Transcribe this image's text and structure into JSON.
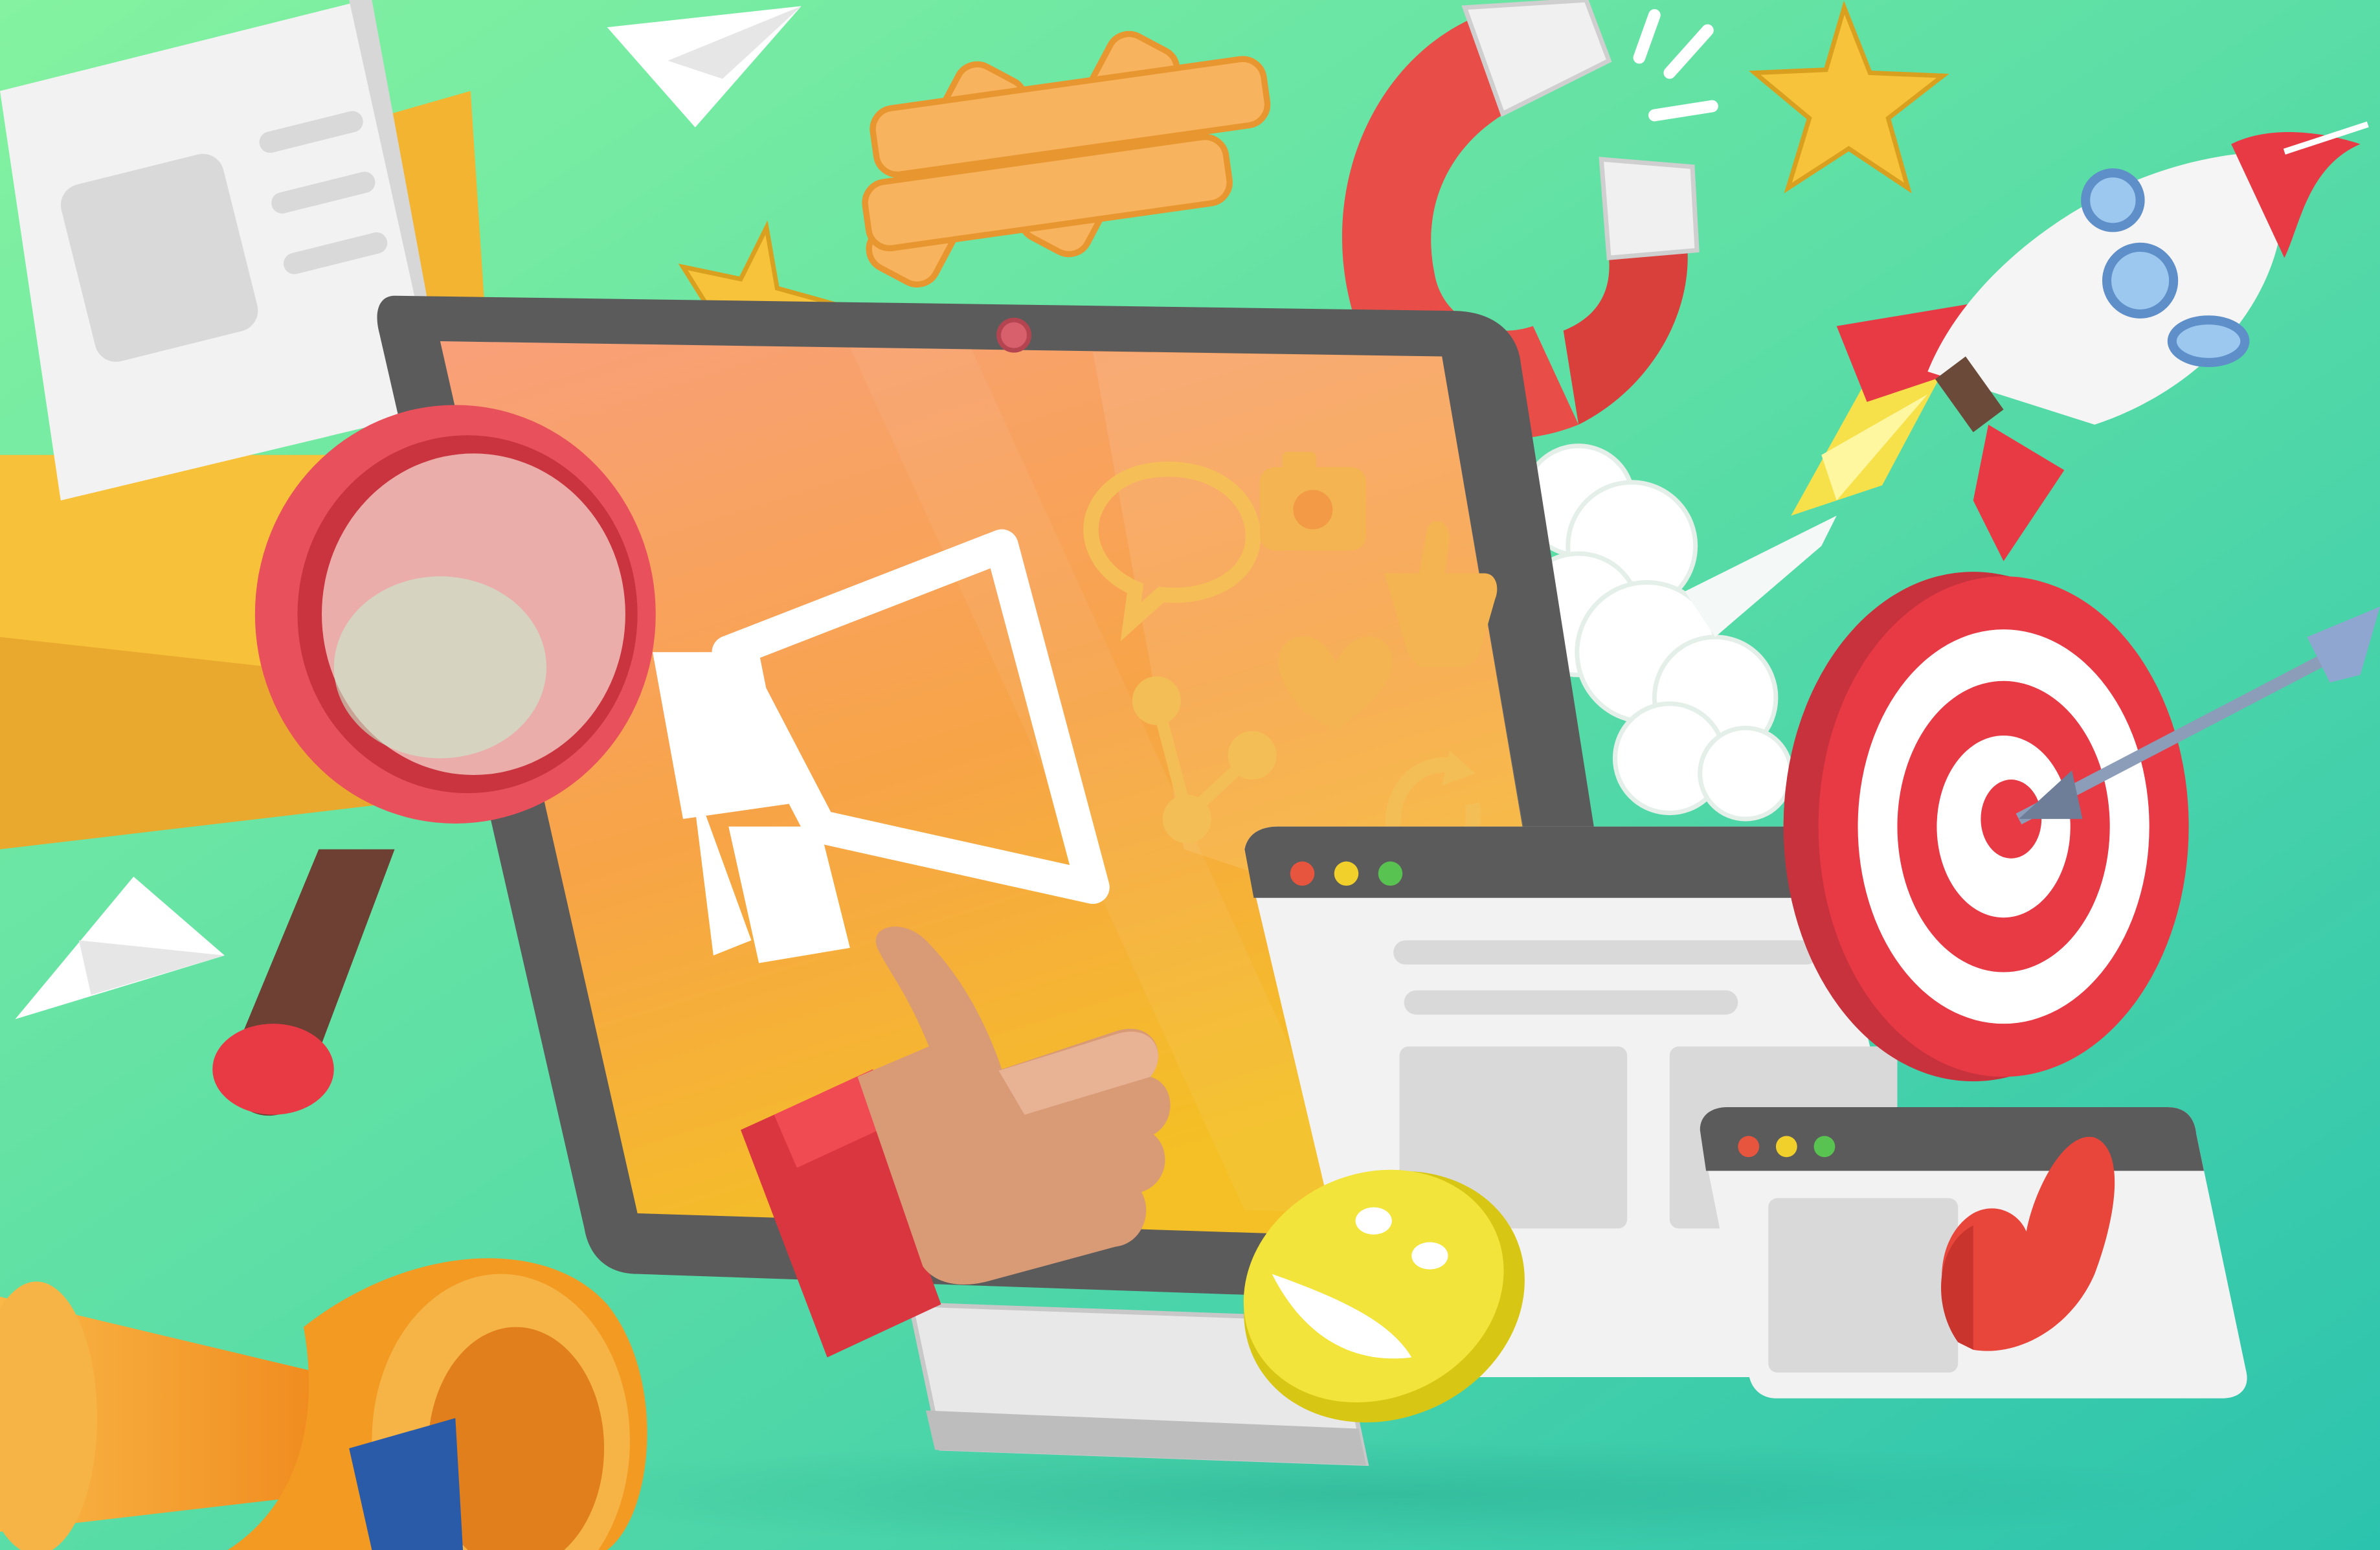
{
  "scene": {
    "subject": "digital-marketing-illustration",
    "colors": {
      "bg_top_left": "#7FF0A0",
      "bg_bottom_right": "#2EC7AE",
      "screen_orange": "#F7A04A",
      "monitor_frame": "#5B5B5B",
      "accent_red": "#E83A45",
      "star_yellow": "#F6C33A",
      "envelope_yellow": "#F7C23A",
      "hashtag_orange": "#F7B35E",
      "window_light": "#F2F2F2"
    },
    "icons": [
      "envelope-icon",
      "newspaper-icon",
      "paper-plane-icon",
      "hashtag-icon",
      "star-icon",
      "magnet-icon",
      "rocket-icon",
      "cloud-smoke-icon",
      "magnifier-icon",
      "monitor-icon",
      "megaphone-icon",
      "chat-bubble-icon",
      "camera-icon",
      "thumbs-up-icon",
      "heart-icon",
      "share-icon",
      "refresh-icon",
      "target-icon",
      "arrow-icon",
      "browser-window-icon",
      "smiley-icon",
      "bullhorn-icon"
    ]
  }
}
